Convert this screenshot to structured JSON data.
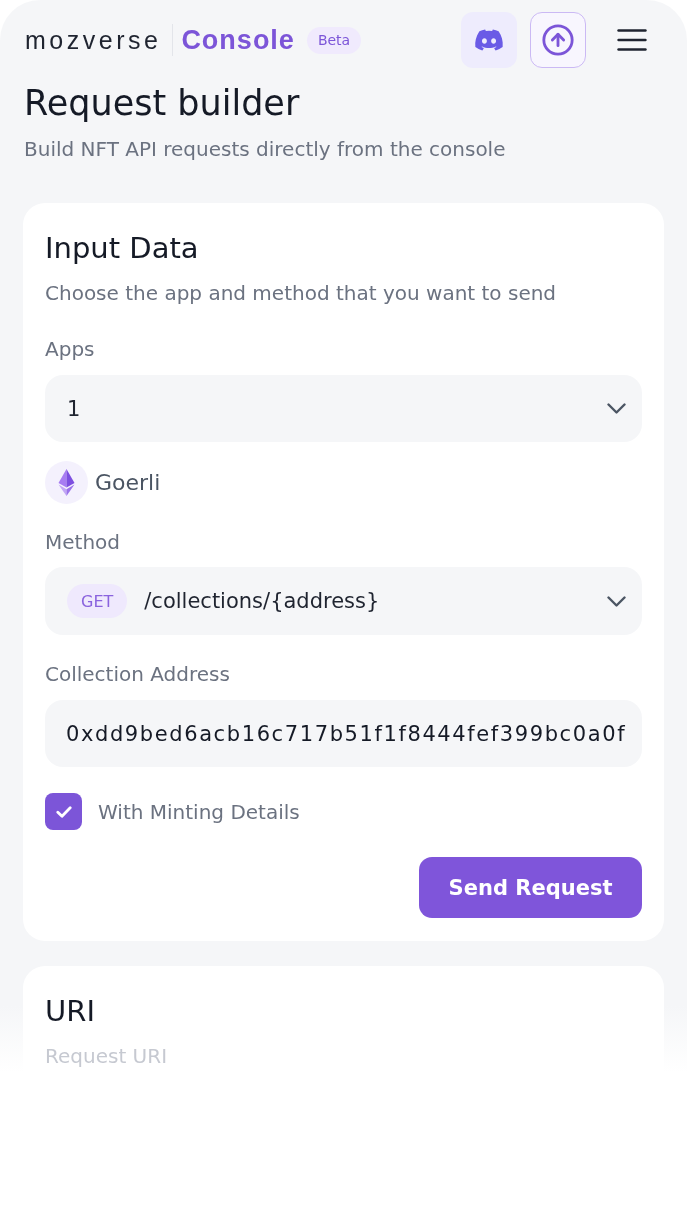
{
  "header": {
    "logo": "mozverse",
    "product": "Console",
    "badge": "Beta"
  },
  "page": {
    "title": "Request builder",
    "subtitle": "Build NFT API requests directly from the console"
  },
  "input_card": {
    "title": "Input Data",
    "subtitle": "Choose the app and method that you want to send",
    "apps": {
      "label": "Apps",
      "value": "1"
    },
    "network": "Goerli",
    "method": {
      "label": "Method",
      "verb": "GET",
      "path": "/collections/{address}"
    },
    "collection_address": {
      "label": "Collection Address",
      "value": "0xdd9bed6acb16c717b51f1f8444fef399bc0a0f"
    },
    "minting_details": {
      "label": "With Minting Details",
      "checked": true
    },
    "send_button": "Send Request"
  },
  "uri_card": {
    "title": "URI",
    "subtitle": "Request URI"
  }
}
